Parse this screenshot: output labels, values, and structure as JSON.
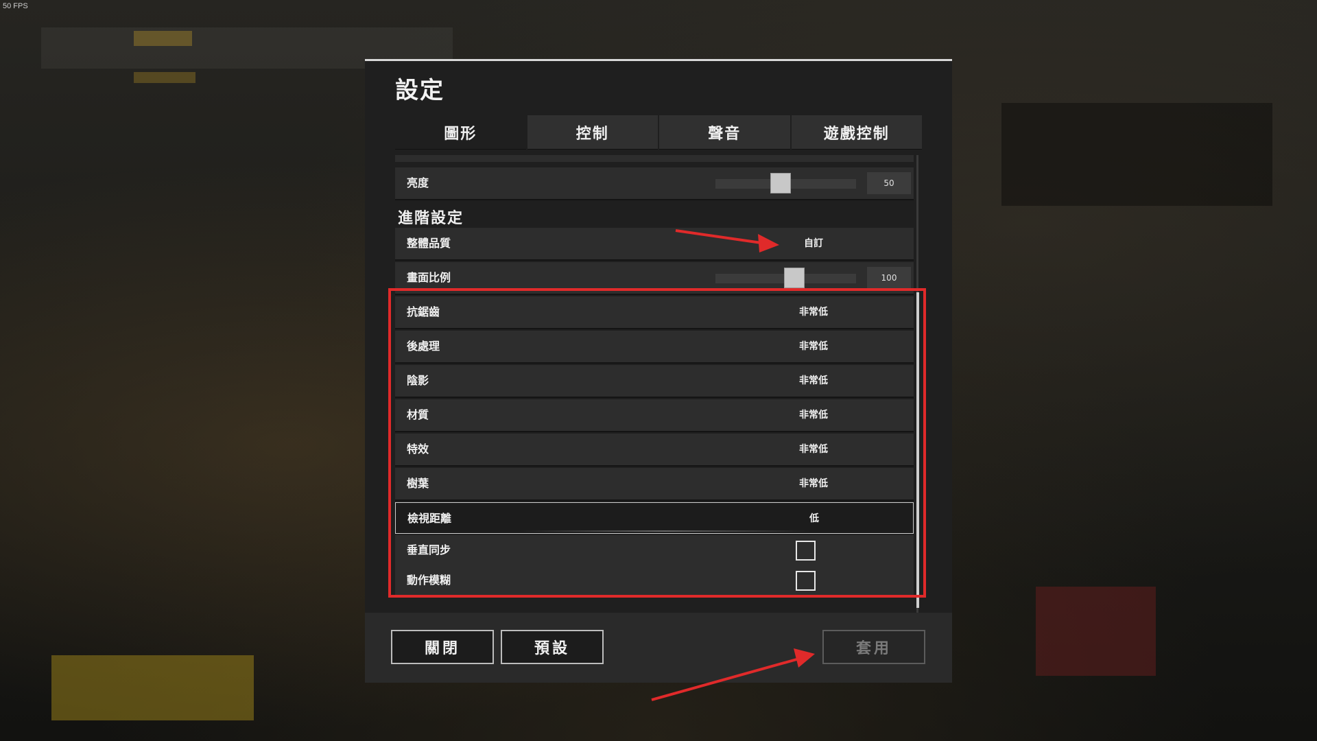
{
  "fps_counter": "50 FPS",
  "settings": {
    "title": "設定",
    "tabs": [
      {
        "label": "圖形",
        "active": true
      },
      {
        "label": "控制",
        "active": false
      },
      {
        "label": "聲音",
        "active": false
      },
      {
        "label": "遊戲控制",
        "active": false
      }
    ],
    "brightness": {
      "label": "亮度",
      "value": "50"
    },
    "advanced_section_title": "進階設定",
    "overall_quality": {
      "label": "整體品質",
      "value": "自訂"
    },
    "screen_scale": {
      "label": "畫面比例",
      "value": "100"
    },
    "options": [
      {
        "label": "抗鋸齒",
        "value": "非常低"
      },
      {
        "label": "後處理",
        "value": "非常低"
      },
      {
        "label": "陰影",
        "value": "非常低"
      },
      {
        "label": "材質",
        "value": "非常低"
      },
      {
        "label": "特效",
        "value": "非常低"
      },
      {
        "label": "樹葉",
        "value": "非常低"
      },
      {
        "label": "檢視距離",
        "value": "低"
      }
    ],
    "vsync": {
      "label": "垂直同步",
      "checked": false
    },
    "motion_blur": {
      "label": "動作模糊",
      "checked": false
    }
  },
  "footer": {
    "close_label": "關閉",
    "default_label": "預設",
    "apply_label": "套用"
  },
  "colors": {
    "annotation_red": "#e02a2a",
    "panel_bg": "#1f1f1f",
    "row_bg": "#2d2d2d"
  }
}
